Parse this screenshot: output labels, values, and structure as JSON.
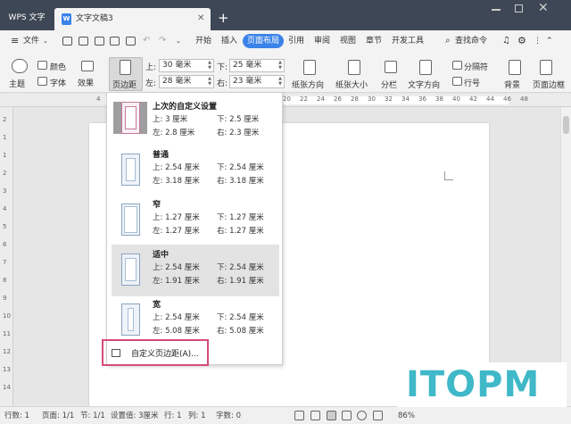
{
  "tabbar": {
    "app_tab": "WPS 文字",
    "doc_tab": "文字文稿3",
    "doc_icon": "W",
    "new_tab_icon": "plus-icon"
  },
  "menu": {
    "file": "文件",
    "items": [
      "开始",
      "插入",
      "页面布局",
      "引用",
      "审阅",
      "视图",
      "章节",
      "开发工具"
    ],
    "active": "页面布局",
    "search": "查找命令"
  },
  "ribbon": {
    "theme": "主题",
    "color": "颜色",
    "font": "字体",
    "effect": "效果",
    "margin": "页边距",
    "top_label": "上:",
    "top_value": "30 毫米",
    "bottom_label": "下:",
    "bottom_value": "25 毫米",
    "left_label": "左:",
    "left_value": "28 毫米",
    "right_label": "右:",
    "right_value": "23 毫米",
    "orientation": "纸张方向",
    "size": "纸张大小",
    "columns": "分栏",
    "text_direction": "文字方向",
    "break": "分隔符",
    "line_number": "行号",
    "background": "背景",
    "page_border": "页面边框"
  },
  "ruler": {
    "top_nums": [
      "4",
      "2",
      "2",
      "4",
      "6",
      "8",
      "10",
      "12",
      "14",
      "16",
      "18",
      "20",
      "22",
      "24",
      "26",
      "28",
      "30",
      "32",
      "34",
      "36",
      "38",
      "40",
      "42",
      "44",
      "46",
      "48"
    ],
    "left_nums": [
      "2",
      "1",
      "1",
      "2",
      "3",
      "4",
      "5",
      "6",
      "7",
      "8",
      "9",
      "10",
      "11",
      "12",
      "13",
      "14"
    ]
  },
  "dropdown": {
    "options": [
      {
        "name": "上次的自定义设置",
        "top": "上: 3 厘米",
        "bottom": "下: 2.5 厘米",
        "left": "左: 2.8 厘米",
        "right": "右: 2.3 厘米"
      },
      {
        "name": "普通",
        "top": "上: 2.54 厘米",
        "bottom": "下: 2.54 厘米",
        "left": "左: 3.18 厘米",
        "right": "右: 3.18 厘米"
      },
      {
        "name": "窄",
        "top": "上: 1.27 厘米",
        "bottom": "下: 1.27 厘米",
        "left": "左: 1.27 厘米",
        "right": "右: 1.27 厘米"
      },
      {
        "name": "适中",
        "top": "上: 2.54 厘米",
        "bottom": "下: 2.54 厘米",
        "left": "左: 1.91 厘米",
        "right": "右: 1.91 厘米"
      },
      {
        "name": "宽",
        "top": "上: 2.54 厘米",
        "bottom": "下: 2.54 厘米",
        "left": "左: 5.08 厘米",
        "right": "右: 5.08 厘米"
      }
    ],
    "selected": "适中",
    "custom": "自定义页边距(A)..."
  },
  "status": {
    "line": "行数: 1",
    "page": "页面: 1/1",
    "section": "节: 1/1",
    "setting": "设置值: 3厘米",
    "row": "行: 1",
    "col": "列: 1",
    "chars": "字数: 0",
    "zoom": "86%"
  },
  "watermark": "ITOPM"
}
